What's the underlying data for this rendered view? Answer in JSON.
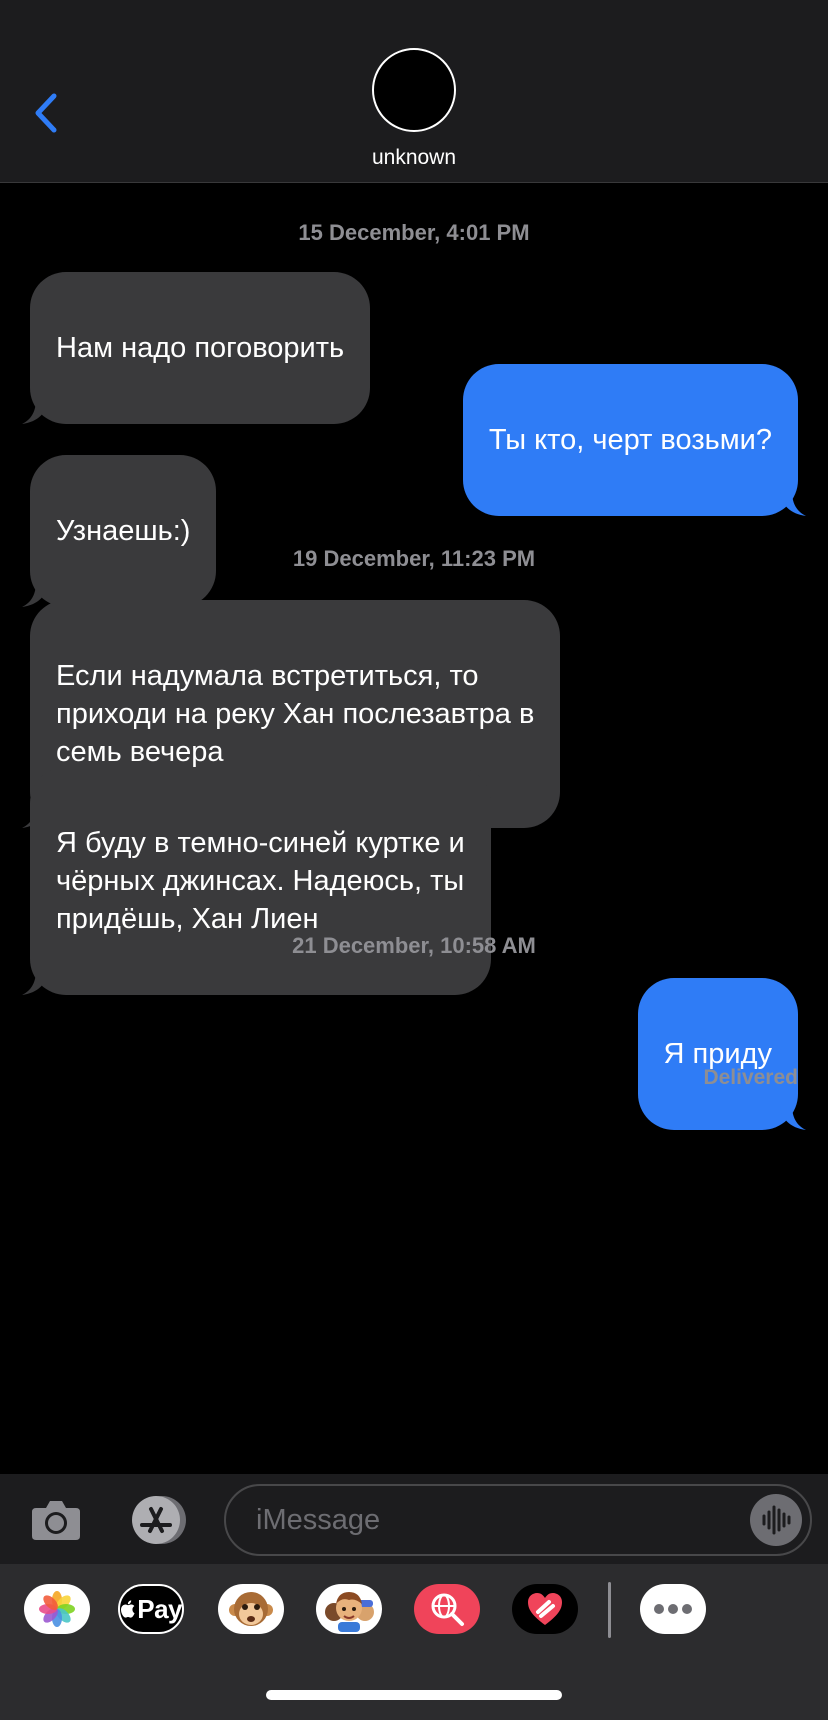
{
  "header": {
    "back_icon": "chevron-left-icon",
    "contact_name": "unknown",
    "accent_color": "#2f7cf6"
  },
  "thread": {
    "timestamps": [
      "15 December, 4:01 PM",
      "19 December, 11:23 PM",
      "21 December, 10:58 AM"
    ],
    "messages": [
      {
        "direction": "incoming",
        "text": "Нам надо поговорить"
      },
      {
        "direction": "outgoing",
        "text": "Ты кто, черт возьми?"
      },
      {
        "direction": "incoming",
        "text": "Узнаешь:)"
      },
      {
        "direction": "incoming",
        "text": "Если надумала встретиться, то\nприходи на реку Хан послезавтра в\nсемь вечера"
      },
      {
        "direction": "incoming",
        "text": "Я буду в темно-синей куртке и\nчёрных джинсах. Надеюсь, ты\nпридёшь, Хан Лиен"
      },
      {
        "direction": "outgoing",
        "text": "Я приду"
      }
    ],
    "status": "Delivered"
  },
  "inputbar": {
    "placeholder": "iMessage",
    "camera_icon": "camera-icon",
    "appstore_icon": "app-store-icon",
    "audio_icon": "audio-waveform-icon"
  },
  "drawer": {
    "apps": [
      {
        "name": "photos-app-icon"
      },
      {
        "name": "apple-pay-app-icon",
        "label": "Pay"
      },
      {
        "name": "animoji-app-icon"
      },
      {
        "name": "memoji-app-icon"
      },
      {
        "name": "web-search-app-icon"
      },
      {
        "name": "digital-touch-app-icon"
      },
      {
        "name": "more-apps-icon"
      }
    ]
  }
}
